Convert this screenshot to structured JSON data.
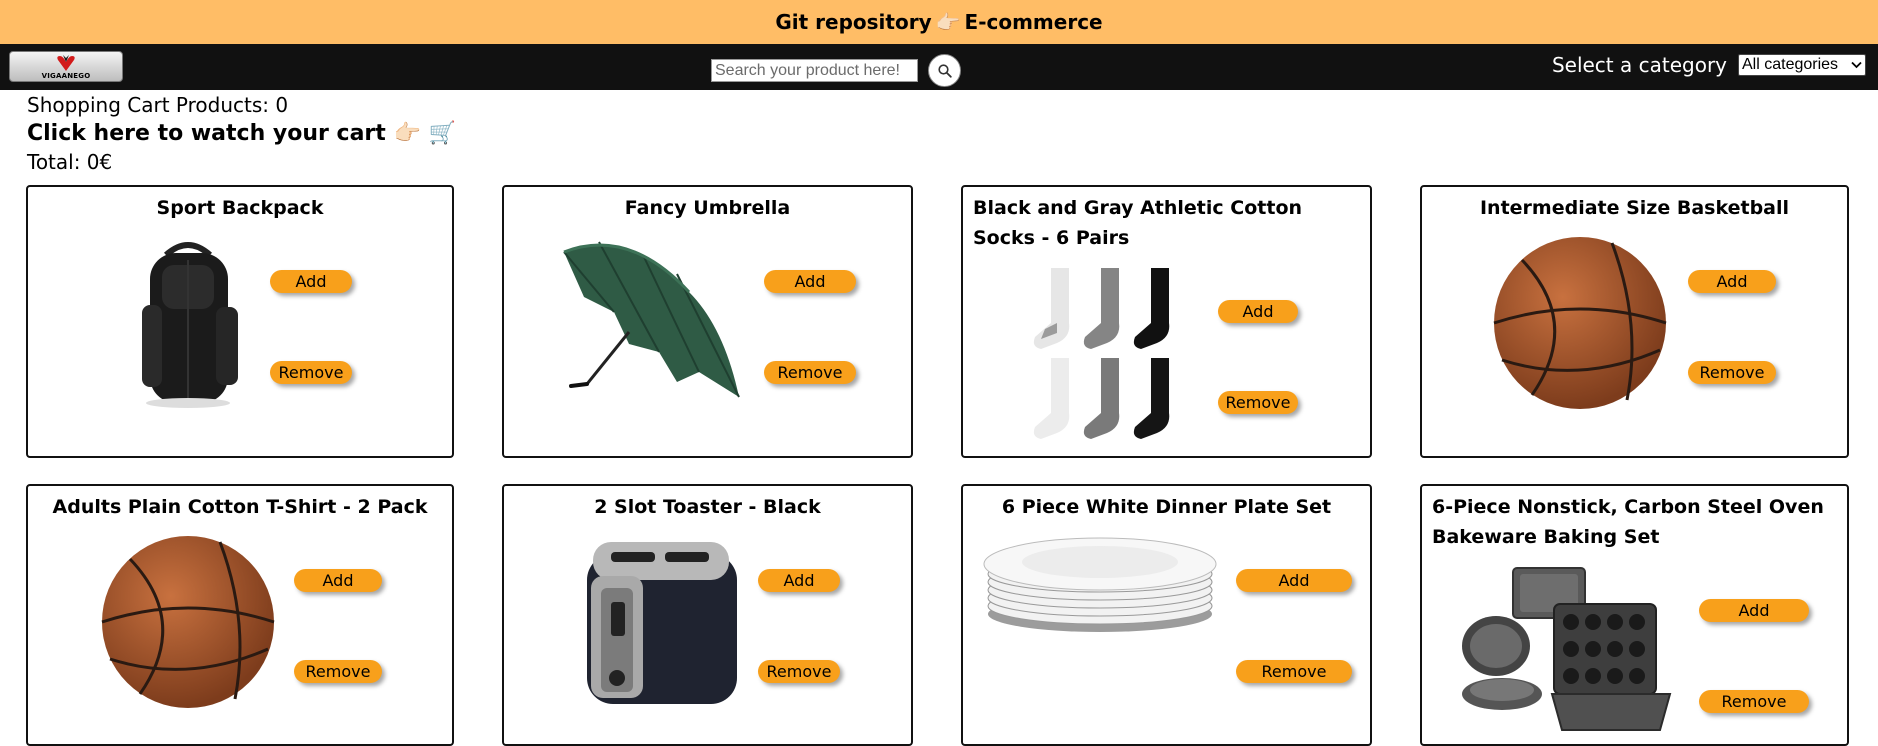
{
  "banner": {
    "text_left": "Git repository",
    "emoji": "👉🏻",
    "text_right": "E-commerce"
  },
  "logo": {
    "text": "VIGAANEGO"
  },
  "search": {
    "placeholder": "Search your product here!"
  },
  "category": {
    "label": "Select a category",
    "selected": "All categories"
  },
  "cart": {
    "count_label": "Shopping Cart Products: 0",
    "watch_label": "Click here to watch your cart 👉🏻 🛒",
    "total_label": "Total: 0€"
  },
  "buttons": {
    "add": "Add",
    "remove": "Remove"
  },
  "products": [
    {
      "title": "Sport Backpack",
      "image": "backpack-image"
    },
    {
      "title": "Fancy Umbrella",
      "image": "umbrella-image"
    },
    {
      "title": "Black and Gray Athletic Cotton Socks - 6 Pairs",
      "image": "socks-image"
    },
    {
      "title": "Intermediate Size Basketball",
      "image": "basketball-image"
    },
    {
      "title": "Adults Plain Cotton T-Shirt - 2 Pack",
      "image": "basketball-image"
    },
    {
      "title": "2 Slot Toaster - Black",
      "image": "toaster-image"
    },
    {
      "title": "6 Piece White Dinner Plate Set",
      "image": "plates-image"
    },
    {
      "title": "6-Piece Nonstick, Carbon Steel Oven Bakeware Baking Set",
      "image": "bakeware-image"
    }
  ],
  "colors": {
    "banner": "#ffbd66",
    "navbar": "#111111",
    "button": "#f8a01b"
  }
}
